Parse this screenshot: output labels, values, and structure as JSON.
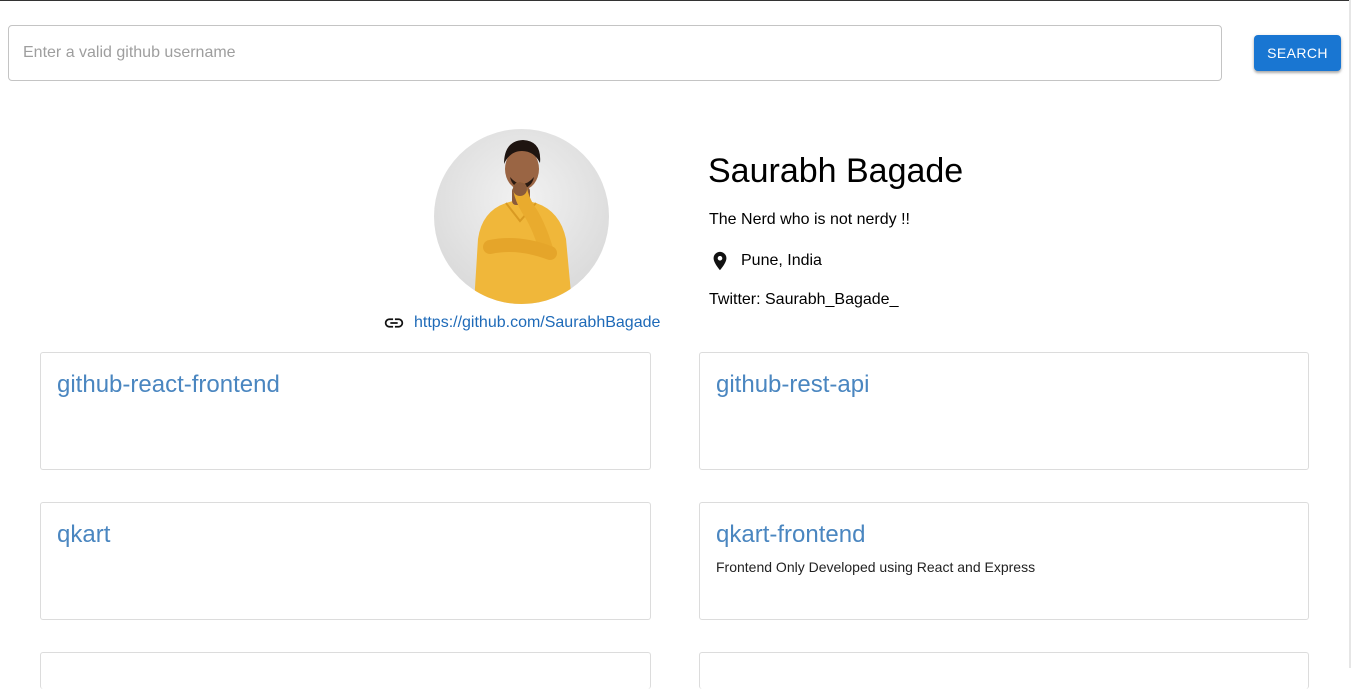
{
  "search": {
    "placeholder": "Enter a valid github username",
    "value": "",
    "button_label": "SEARCH"
  },
  "profile": {
    "name": "Saurabh Bagade",
    "bio": "The Nerd who is not nerdy !!",
    "location": "Pune, India",
    "twitter": "Twitter: Saurabh_Bagade_",
    "link": "https://github.com/SaurabhBagade",
    "avatar_icon": "avatar-photo"
  },
  "repos": [
    {
      "name": "github-react-frontend",
      "description": ""
    },
    {
      "name": "github-rest-api",
      "description": ""
    },
    {
      "name": "qkart",
      "description": ""
    },
    {
      "name": "qkart-frontend",
      "description": "Frontend Only Developed using React and Express"
    },
    {
      "name": "",
      "description": ""
    },
    {
      "name": "",
      "description": ""
    }
  ],
  "colors": {
    "primary": "#1976d2",
    "repo_link": "#4a86c0",
    "profile_link": "#1e6ab8"
  },
  "icons": {
    "link": "link-icon",
    "location": "location-pin-icon"
  }
}
